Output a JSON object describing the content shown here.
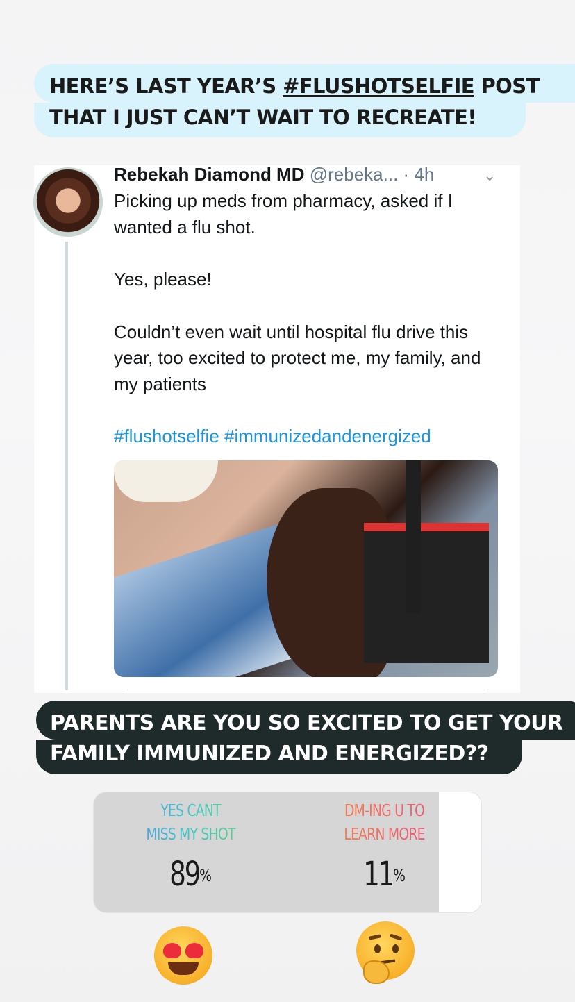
{
  "caption_top": {
    "line1_pre": "HERE’S LAST YEAR’S ",
    "line1_hashtag": "#FLUSHOTSELFIE",
    "line1_post": " POST",
    "line2": "THAT I JUST CAN’T WAIT TO RECREATE!"
  },
  "tweet": {
    "name": "Rebekah Diamond MD",
    "handle": "@rebeka...",
    "time": "· 4h",
    "body": [
      "Picking up meds from pharmacy, asked if I wanted a flu shot.",
      "Yes, please!",
      "Couldn’t even wait until hospital flu drive this year, too excited to protect me, my family, and my patients"
    ],
    "hashtags": "#flushotselfie #immunizedandenergized"
  },
  "caption_bottom": {
    "line1": "PARENTS ARE YOU SO EXCITED TO GET YOUR",
    "line2": "FAMILY IMMUNIZED AND ENERGIZED??"
  },
  "poll": {
    "options": [
      {
        "line1": "YES CANT",
        "line2": "MISS MY SHOT",
        "percent": "89",
        "percent_sign": "%",
        "fraction": 0.89
      },
      {
        "line1": "DM-ING U TO",
        "line2": "LEARN MORE",
        "percent": "11",
        "percent_sign": "%",
        "fraction": 0.11
      }
    ]
  },
  "emojis": {
    "left": "heart-eyes-emoji",
    "right": "thinking-face-emoji"
  },
  "colors": {
    "caption_top_bg": "#d8f3fb",
    "caption_bottom_bg": "#1f2b2b",
    "hashtag_blue": "#1b95e0",
    "poll_fill": "#d6d6d6"
  }
}
